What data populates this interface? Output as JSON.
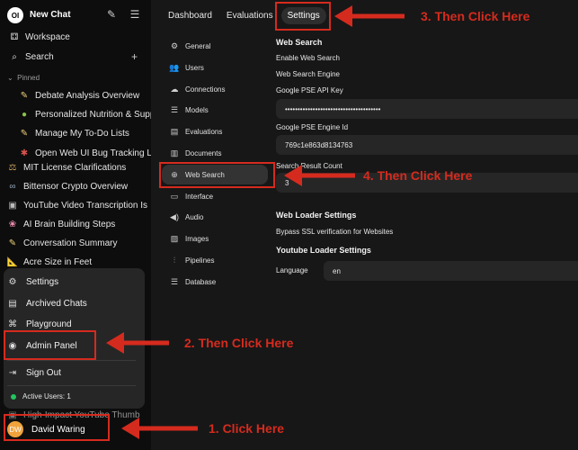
{
  "sidebar": {
    "logo": "OI",
    "new_chat": "New Chat",
    "workspace": "Workspace",
    "search": "Search",
    "pinned_label": "Pinned",
    "pinned_items": [
      {
        "label": "Debate Analysis Overview",
        "icon": "memo-emoji"
      },
      {
        "label": "Personalized Nutrition & Supp",
        "icon": "green-circle-emoji"
      },
      {
        "label": "Manage My To-Do Lists",
        "icon": "memo-emoji"
      },
      {
        "label": "Open Web UI Bug Tracking Le",
        "icon": "bug-emoji"
      }
    ],
    "chats": [
      {
        "label": "MIT License Clarifications",
        "icon": "scales-emoji"
      },
      {
        "label": "Bittensor Crypto Overview",
        "icon": "link-emoji"
      },
      {
        "label": "YouTube Video Transcription Is",
        "icon": "video-emoji"
      },
      {
        "label": "AI Brain Building Steps",
        "icon": "brain-emoji"
      },
      {
        "label": "Conversation Summary",
        "icon": "memo-emoji"
      },
      {
        "label": "Acre Size in Feet",
        "icon": "ruler-emoji"
      },
      {
        "label": "High-Impact YouTube Thumb",
        "icon": "video-emoji"
      }
    ],
    "menu": {
      "settings": "Settings",
      "archived": "Archived Chats",
      "playground": "Playground",
      "admin": "Admin Panel",
      "signout": "Sign Out",
      "active_users": "Active Users: 1"
    },
    "user": {
      "initials": "DW",
      "name": "David Waring"
    }
  },
  "tabs": [
    "Dashboard",
    "Evaluations",
    "Settings"
  ],
  "settings_nav": [
    "General",
    "Users",
    "Connections",
    "Models",
    "Evaluations",
    "Documents",
    "Web Search",
    "Interface",
    "Audio",
    "Images",
    "Pipelines",
    "Database"
  ],
  "content": {
    "heading": "Web Search",
    "enable": "Enable Web Search",
    "engine": "Web Search Engine",
    "api_key_label": "Google PSE API Key",
    "api_key_value": "••••••••••••••••••••••••••••••••••••••",
    "engine_id_label": "Google PSE Engine Id",
    "engine_id_value": "769c1e863d8134763",
    "count_label": "Search Result Count",
    "count_value": "3",
    "loader_heading": "Web Loader Settings",
    "bypass_ssl": "Bypass SSL verification for Websites",
    "youtube_heading": "Youtube Loader Settings",
    "language_label": "Language",
    "language_value": "en"
  },
  "annotations": {
    "step1": "1. Click Here",
    "step2": "2. Then Click Here",
    "step3": "3. Then Click Here",
    "step4": "4. Then Click Here"
  },
  "colors": {
    "annotation": "#d52b1e",
    "active_dot": "#22c55e",
    "avatar": "#f0a33c"
  }
}
